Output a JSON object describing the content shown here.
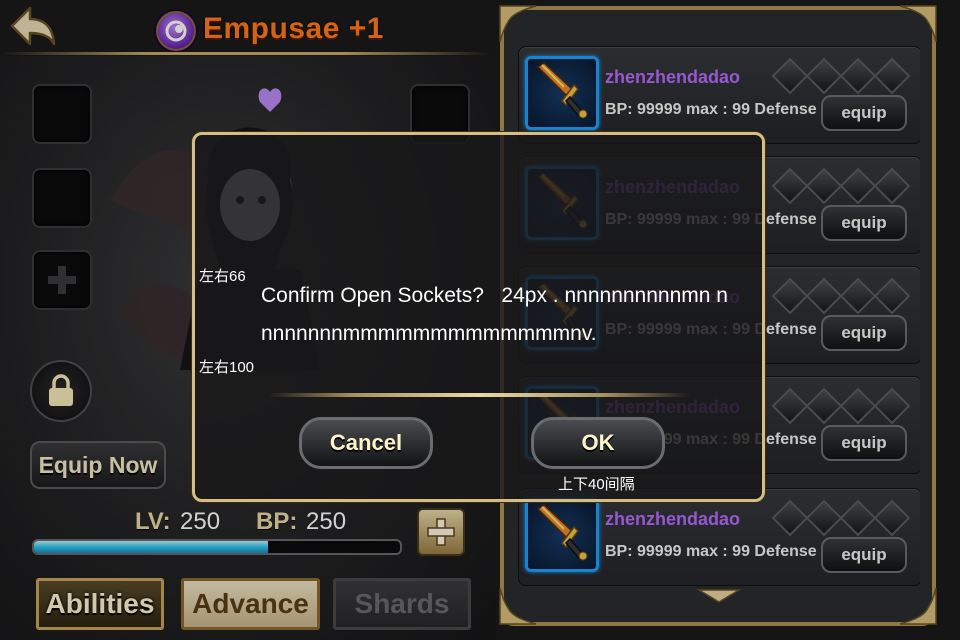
{
  "header": {
    "title": "Empusae +1",
    "back_icon": "back-arrow-icon",
    "badge_icon": "hero-element-icon"
  },
  "left_panel": {
    "equip_now_label": "Equip Now",
    "lock_icon": "lock-icon",
    "stats": {
      "lv_label": "LV:",
      "lv_value": "250",
      "bp_label": "BP:",
      "bp_value": "250",
      "exp_fraction": 0.64
    },
    "plus_icon": "plus-icon"
  },
  "tabs": [
    {
      "label": "Abilities"
    },
    {
      "label": "Advance"
    },
    {
      "label": "Shards"
    }
  ],
  "item_list": {
    "items": [
      {
        "name": "zhenzhendadao",
        "stats": "BP: 99999 max : 99 Defense",
        "equip_label": "equip"
      },
      {
        "name": "zhenzhendadao",
        "stats": "BP: 99999 max : 99 Defense",
        "equip_label": "equip"
      },
      {
        "name": "zhenzhendadao",
        "stats": "BP: 99999 max : 99 Defense",
        "equip_label": "equip"
      },
      {
        "name": "zhenzhendadao",
        "stats": "BP: 99999 max : 99 Defense",
        "equip_label": "equip"
      },
      {
        "name": "zhenzhendadao",
        "stats": "BP: 99999 max : 99 Defense",
        "equip_label": "equip"
      }
    ]
  },
  "modal": {
    "message": "Confirm Open Sockets?   24px . nnnnnnnnnnmn nnnnnnnnmmmmmmmmmmmmmnv.",
    "note_left_top": "左右66",
    "note_left_bottom": "左右100",
    "note_bottom": "上下40间隔",
    "cancel_label": "Cancel",
    "ok_label": "OK"
  },
  "colors": {
    "gold_border": "#d6bd86",
    "hero_name": "#ff7a1c",
    "item_name": "#b96bff",
    "icon_frame": "#1ea0ff",
    "exp_fill": "#2ec6ee"
  }
}
